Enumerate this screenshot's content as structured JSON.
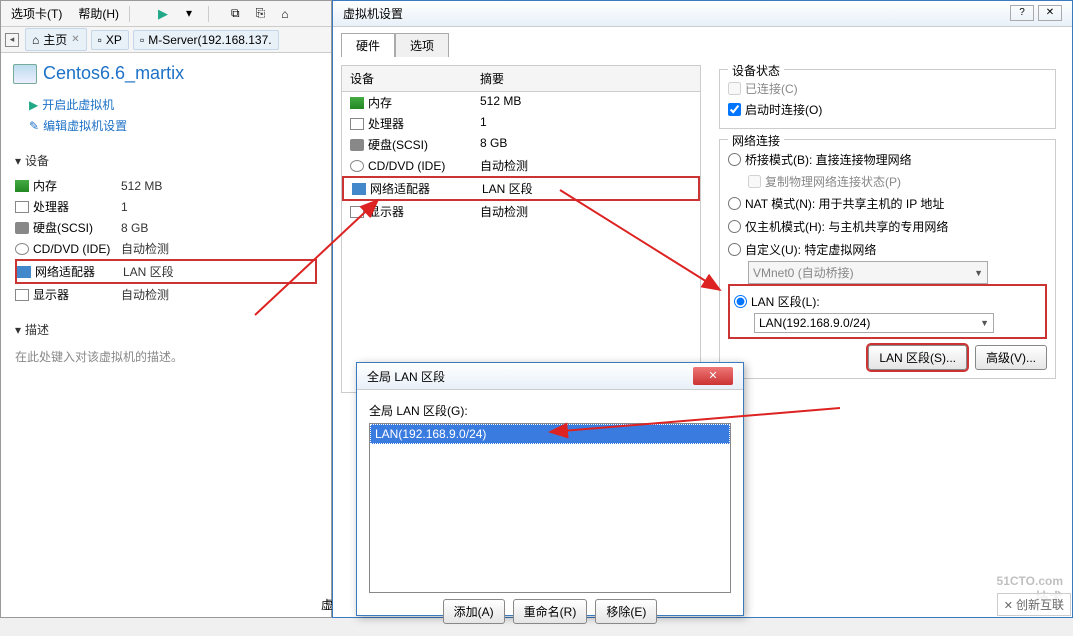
{
  "menu": {
    "tab": "选项卡(T)",
    "help": "帮助(H)"
  },
  "tabs": {
    "home": "主页",
    "xp": "XP",
    "mserver": "M-Server(192.168.137."
  },
  "vm": {
    "title": "Centos6.6_martix",
    "start": "开启此虚拟机",
    "edit": "编辑虚拟机设置"
  },
  "section": {
    "devices": "设备",
    "desc": "描述"
  },
  "devices": {
    "mem": {
      "label": "内存",
      "value": "512 MB"
    },
    "cpu": {
      "label": "处理器",
      "value": "1"
    },
    "hdd": {
      "label": "硬盘(SCSI)",
      "value": "8 GB"
    },
    "cd": {
      "label": "CD/DVD (IDE)",
      "value": "自动检测"
    },
    "net": {
      "label": "网络适配器",
      "value": "LAN 区段"
    },
    "disp": {
      "label": "显示器",
      "value": "自动检测"
    }
  },
  "desc_text": "在此处键入对该虚拟机的描述。",
  "settings": {
    "title": "虚拟机设置",
    "tab_hw": "硬件",
    "tab_opt": "选项",
    "col_device": "设备",
    "col_summary": "摘要",
    "state_group": "设备状态",
    "connected": "已连接(C)",
    "connect_on": "启动时连接(O)",
    "net_group": "网络连接",
    "bridged": "桥接模式(B): 直接连接物理网络",
    "replicate": "复制物理网络连接状态(P)",
    "nat": "NAT 模式(N): 用于共享主机的 IP 地址",
    "hostonly": "仅主机模式(H): 与主机共享的专用网络",
    "custom": "自定义(U): 特定虚拟网络",
    "vmnet": "VMnet0 (自动桥接)",
    "lanseg": "LAN 区段(L):",
    "lan_value": "LAN(192.168.9.0/24)",
    "btn_lan": "LAN 区段(S)...",
    "btn_adv": "高级(V)..."
  },
  "lan_dialog": {
    "title": "全局 LAN 区段",
    "label": "全局 LAN 区段(G):",
    "item": "LAN(192.168.9.0/24)",
    "add": "添加(A)",
    "rename": "重命名(R)",
    "remove": "移除(E)"
  },
  "bottom_label": "虚",
  "watermark": {
    "main": "51CTO.com",
    "sub": "技术"
  },
  "partner": "创新互联"
}
